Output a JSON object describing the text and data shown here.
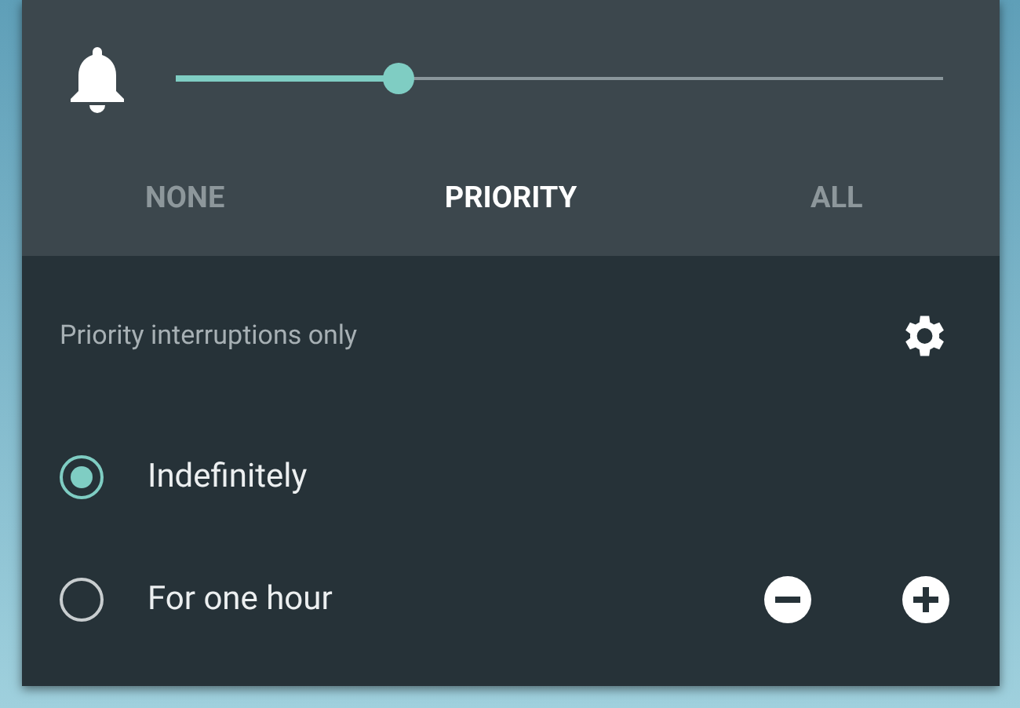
{
  "volume": {
    "level": 0.29
  },
  "modes": [
    {
      "label": "NONE",
      "selected": false
    },
    {
      "label": "PRIORITY",
      "selected": true
    },
    {
      "label": "ALL",
      "selected": false
    }
  ],
  "summary": "Priority interruptions only",
  "durations": [
    {
      "label": "Indefinitely",
      "selected": true,
      "adjustable": false
    },
    {
      "label": "For one hour",
      "selected": false,
      "adjustable": true
    }
  ]
}
